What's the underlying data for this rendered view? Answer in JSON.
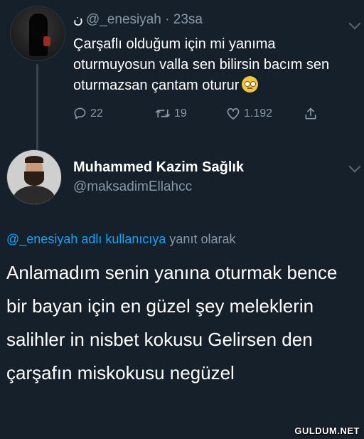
{
  "tweet1": {
    "glyph": "ن",
    "handle": "@_enesiyah · 23sa",
    "text": "Çarşaflı olduğum için mi yanıma oturmuyosun valla sen bilirsin bacım sen oturmazsan çantam oturur",
    "emoji": "eye-roll-emoji",
    "replies": "22",
    "retweets": "19",
    "likes": "1.192"
  },
  "tweet2": {
    "name": "Muhammed Kazim Sağlık",
    "handle": "@maksadimEllahcc",
    "replying_link": "@_enesiyah adlı kullanıcıya",
    "replying_suffix": "yanıt olarak",
    "text": "Anlamadım senin yanına oturmak bence bir bayan için en güzel şey meleklerin salihler in nisbet kokusu Gelirsen den çarşafın miskokusu negüzel"
  },
  "watermark": "GULDUM.NET",
  "colors": {
    "background": "#15202b",
    "secondary_text": "#8899a6",
    "link": "#1da1f2"
  }
}
